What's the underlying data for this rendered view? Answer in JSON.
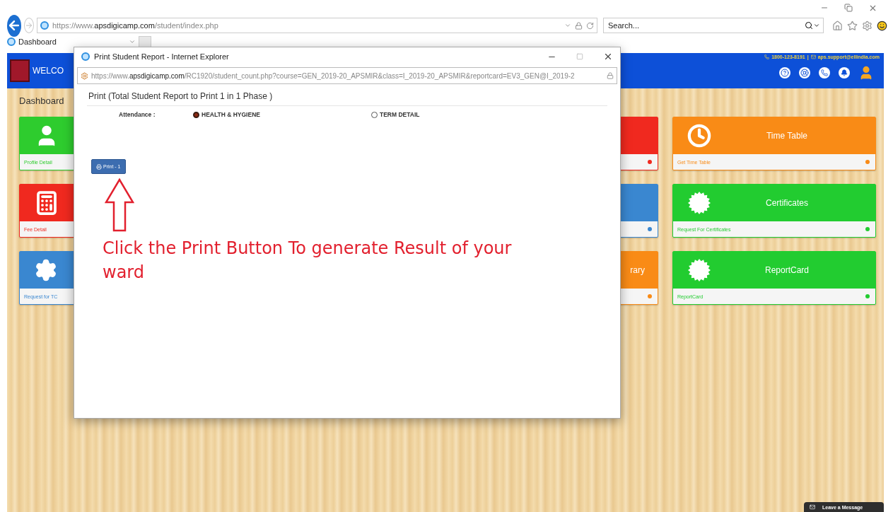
{
  "browser": {
    "url": "https://www.**apsdigicamp.com**/student/index.php",
    "search": {
      "placeholder": "Search..."
    },
    "tab": {
      "title": "Dashboard"
    }
  },
  "header": {
    "welcome": "WELCO",
    "phone": "1800-123-8191",
    "separator": "|",
    "email": "aps.support@ellindia.com"
  },
  "dashboard": {
    "title": "Dashboard",
    "columns": [
      {
        "tiles": [
          {
            "kind": "user",
            "color": "#2ecc2e",
            "link": "Profile Detail"
          },
          {
            "kind": "calculator",
            "color": "#f0291f",
            "link": "Fee Detail"
          },
          {
            "kind": "gear",
            "color": "#3a87d0",
            "link": "Request for TC"
          }
        ]
      },
      {
        "tiles": [
          {
            "kind": "plain",
            "color": "#f0291f"
          },
          {
            "kind": "plain",
            "color": "#3a87d0"
          },
          {
            "kind": "plain",
            "color": "#f98b16",
            "title": "rary"
          }
        ]
      },
      {
        "tiles": [
          {
            "kind": "clock",
            "color": "#f98b16",
            "title": "Time Table",
            "link": "Get Time Table"
          },
          {
            "kind": "burst",
            "color": "#22cc30",
            "title": "Certificates",
            "link": "Request For Certificates"
          },
          {
            "kind": "burst",
            "color": "#22cc30",
            "title": "ReportCard",
            "link": "ReportCard"
          }
        ]
      }
    ]
  },
  "popup": {
    "title": "Print Student Report - Internet Explorer",
    "url": "https://www.**apsdigicamp.com**/RC1920/student_count.php?course=GEN_2019-20_APSMIR&class=I_2019-20_APSMIR&reportcard=EV3_GEN@I_2019-2",
    "heading": "Print (Total Student Report to Print 1 in 1 Phase )",
    "attendance_label": "Attendance :",
    "options": [
      {
        "label": "HEALTH & HYGIENE",
        "selected": true
      },
      {
        "label": "TERM DETAIL",
        "selected": false
      }
    ],
    "print_button": "Print - 1",
    "instruction": "Click the Print Button To generate Result of your ward"
  },
  "chat": {
    "label": "Leave a Message"
  }
}
